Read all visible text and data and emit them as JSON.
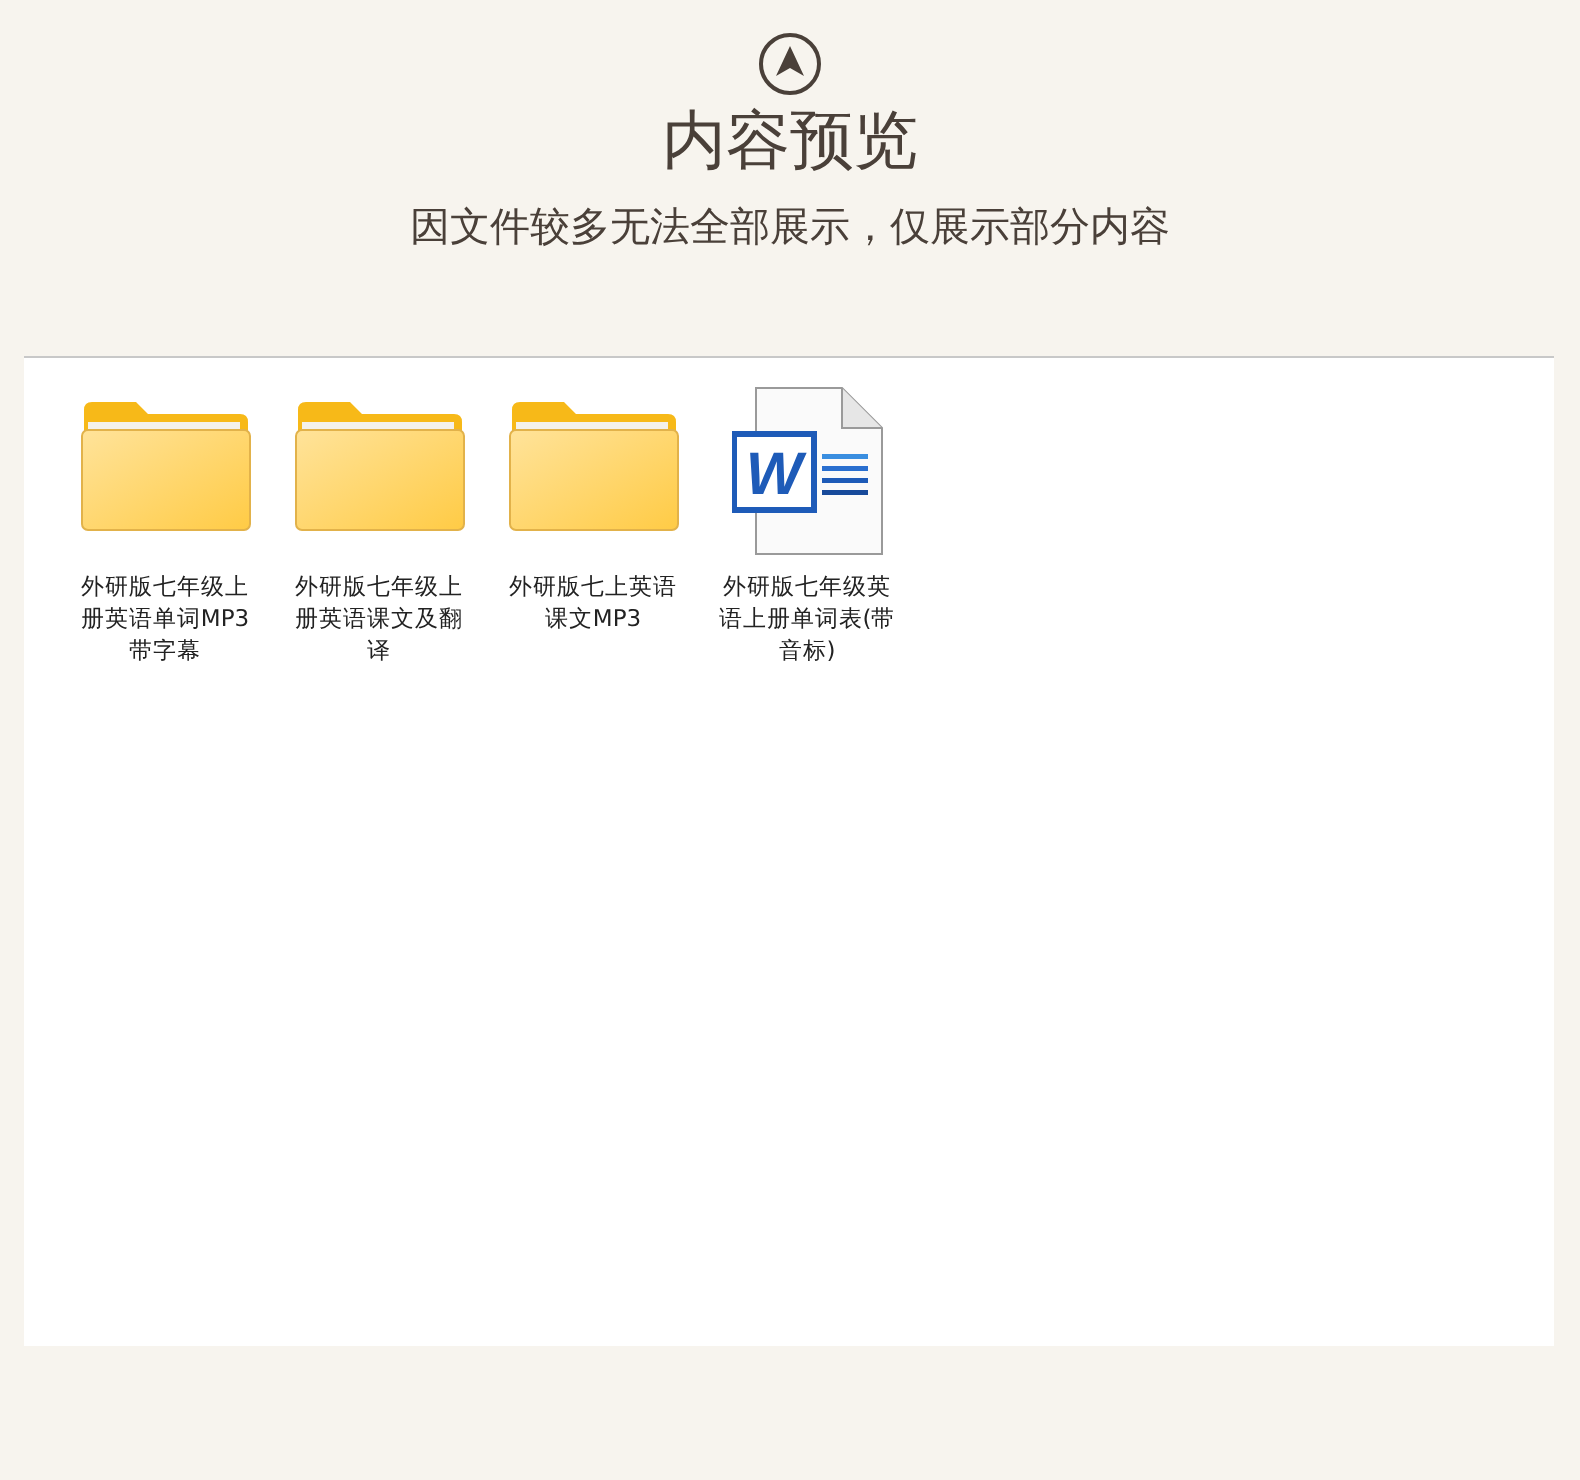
{
  "header": {
    "title": "内容预览",
    "subtitle": "因文件较多无法全部展示，仅展示部分内容"
  },
  "files": [
    {
      "kind": "folder",
      "name": "外研版七年级上册英语单词MP3带字幕"
    },
    {
      "kind": "folder",
      "name": "外研版七年级上册英语课文及翻译"
    },
    {
      "kind": "folder",
      "name": "外研版七上英语课文MP3"
    },
    {
      "kind": "word",
      "icon_letter": "W",
      "name": "外研版七年级英语上册单词表(带音标)"
    }
  ]
}
